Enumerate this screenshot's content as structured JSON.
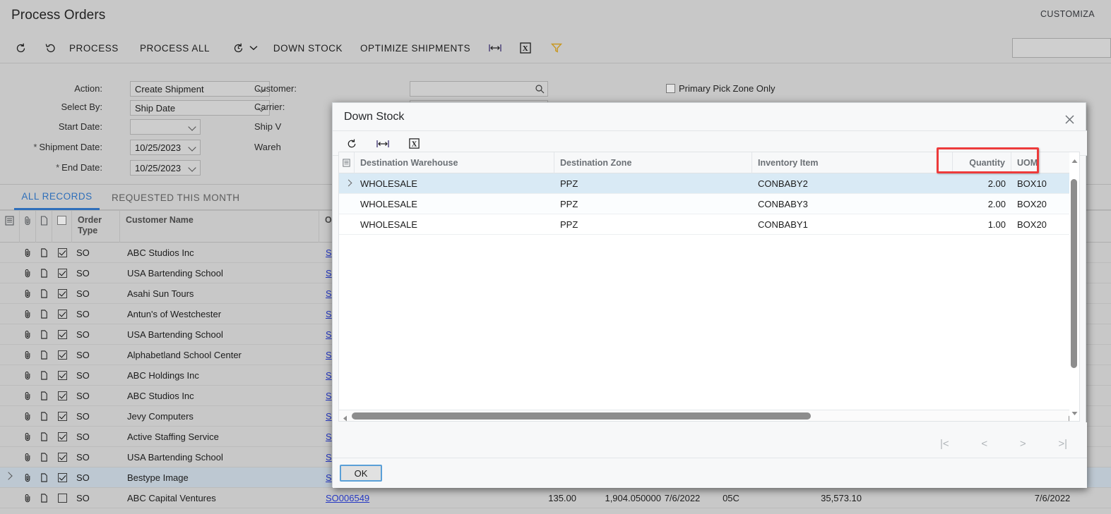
{
  "page": {
    "title": "Process Orders",
    "customization_label": "CUSTOMIZA"
  },
  "toolbar": {
    "refresh_icon": "refresh-icon",
    "undo_icon": "undo-icon",
    "process_label": "PROCESS",
    "process_all_label": "PROCESS ALL",
    "history_icon": "history-clock-icon",
    "dropdown_icon": "chevron-down-icon",
    "down_stock_label": "DOWN STOCK",
    "optimize_shipments_label": "OPTIMIZE SHIPMENTS",
    "fit_columns_icon": "fit-columns-icon",
    "export_excel_icon": "export-excel-icon",
    "filter_icon": "filter-funnel-icon",
    "search_value": "",
    "search_placeholder": ""
  },
  "filters": {
    "action": {
      "label": "Action:",
      "value": "Create Shipment"
    },
    "select_by": {
      "label": "Select By:",
      "value": "Ship Date"
    },
    "start_date": {
      "label": "Start Date:",
      "value": ""
    },
    "shipment_date": {
      "label": "Shipment Date:",
      "value": "10/25/2023",
      "required": "*"
    },
    "end_date": {
      "label": "End Date:",
      "value": "10/25/2023",
      "required": "*"
    },
    "customer": {
      "label": "Customer:",
      "value": ""
    },
    "carrier": {
      "label": "Carrier:",
      "value": ""
    },
    "ship_via": {
      "label": "Ship V",
      "value": ""
    },
    "warehouse": {
      "label": "Wareh",
      "value": ""
    },
    "primary_pick_zone": {
      "label": "Primary Pick Zone Only",
      "checked": false
    }
  },
  "tabs": [
    {
      "label": "ALL RECORDS",
      "active": true
    },
    {
      "label": "REQUESTED THIS MONTH",
      "active": false
    }
  ],
  "main_grid": {
    "headers": [
      "",
      "",
      "",
      "",
      "Order Type",
      "Customer Name",
      "Or"
    ],
    "rows": [
      {
        "selected": false,
        "checked": true,
        "order_type": "SO",
        "customer": "ABC Studios Inc",
        "order_nbr": "S"
      },
      {
        "selected": false,
        "checked": true,
        "order_type": "SO",
        "customer": "USA Bartending School",
        "order_nbr": "S"
      },
      {
        "selected": false,
        "checked": true,
        "order_type": "SO",
        "customer": "Asahi Sun Tours",
        "order_nbr": "S"
      },
      {
        "selected": false,
        "checked": true,
        "order_type": "SO",
        "customer": "Antun's of Westchester",
        "order_nbr": "S"
      },
      {
        "selected": false,
        "checked": true,
        "order_type": "SO",
        "customer": "USA Bartending School",
        "order_nbr": "S"
      },
      {
        "selected": false,
        "checked": true,
        "order_type": "SO",
        "customer": "Alphabetland School Center",
        "order_nbr": "S"
      },
      {
        "selected": false,
        "checked": true,
        "order_type": "SO",
        "customer": "ABC Holdings Inc",
        "order_nbr": "S"
      },
      {
        "selected": false,
        "checked": true,
        "order_type": "SO",
        "customer": "ABC Studios Inc",
        "order_nbr": "S"
      },
      {
        "selected": false,
        "checked": true,
        "order_type": "SO",
        "customer": "Jevy Computers",
        "order_nbr": "S"
      },
      {
        "selected": false,
        "checked": true,
        "order_type": "SO",
        "customer": "Active Staffing Service",
        "order_nbr": "S"
      },
      {
        "selected": false,
        "checked": true,
        "order_type": "SO",
        "customer": "USA Bartending School",
        "order_nbr": "S"
      },
      {
        "selected": true,
        "checked": true,
        "order_type": "SO",
        "customer": "Bestype Image",
        "order_nbr": "S"
      },
      {
        "selected": false,
        "checked": false,
        "order_type": "SO",
        "customer": "ABC Capital Ventures",
        "order_nbr": "SO006549",
        "qty": "135.00",
        "amount": "1,904.050000",
        "date1": "7/6/2022",
        "code": "05C",
        "total": "35,573.10",
        "date2": "7/6/2022"
      }
    ]
  },
  "dialog": {
    "title": "Down Stock",
    "close_icon": "close-icon",
    "toolbar": {
      "refresh_icon": "refresh-icon",
      "fit_columns_icon": "fit-columns-icon",
      "export_excel_icon": "export-excel-icon"
    },
    "grid": {
      "headers": [
        "Destination Warehouse",
        "Destination Zone",
        "Inventory Item",
        "",
        "Quantity",
        "UOM"
      ],
      "rows": [
        {
          "warehouse": "WHOLESALE",
          "zone": "PPZ",
          "item": "CONBABY2",
          "qty": "2.00",
          "uom": "BOX10",
          "selected": true
        },
        {
          "warehouse": "WHOLESALE",
          "zone": "PPZ",
          "item": "CONBABY3",
          "qty": "2.00",
          "uom": "BOX20",
          "selected": false
        },
        {
          "warehouse": "WHOLESALE",
          "zone": "PPZ",
          "item": "CONBABY1",
          "qty": "1.00",
          "uom": "BOX20",
          "selected": false
        }
      ]
    },
    "pager": {
      "first": "|<",
      "prev": "<",
      "next": ">",
      "last": ">|"
    },
    "ok_label": "OK"
  },
  "colors": {
    "accent": "#2f6fba",
    "highlight": "#ed3b3b",
    "link": "#2437c4",
    "row_selected": "#bdc8d2",
    "dialog_row_selected": "#d9eaf5"
  }
}
